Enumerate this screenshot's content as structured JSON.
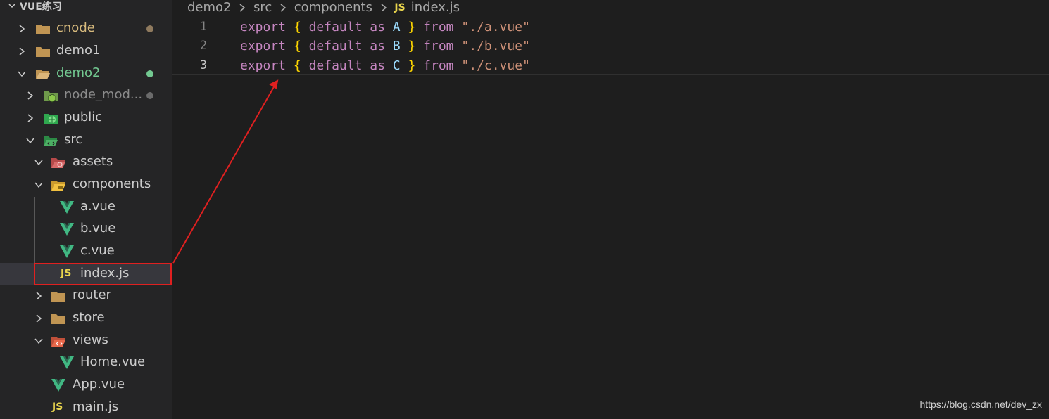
{
  "explorer": {
    "root_label": "VUE练习",
    "items": [
      {
        "label": "cnode"
      },
      {
        "label": "demo1"
      },
      {
        "label": "demo2"
      },
      {
        "label": "node_mod..."
      },
      {
        "label": "public"
      },
      {
        "label": "src"
      },
      {
        "label": "assets"
      },
      {
        "label": "components"
      },
      {
        "label": "a.vue"
      },
      {
        "label": "b.vue"
      },
      {
        "label": "c.vue"
      },
      {
        "label": "index.js"
      },
      {
        "label": "router"
      },
      {
        "label": "store"
      },
      {
        "label": "views"
      },
      {
        "label": "Home.vue"
      },
      {
        "label": "App.vue"
      },
      {
        "label": "main.js"
      }
    ],
    "js_badge": "JS"
  },
  "breadcrumb": {
    "items": [
      "demo2",
      "src",
      "components"
    ],
    "file_icon": "JS",
    "file": "index.js"
  },
  "editor": {
    "lines": [
      {
        "number": "1",
        "kw": "export",
        "open": "{",
        "def": "default",
        "as": "as",
        "name": "A",
        "close": "}",
        "from": "from",
        "path": "\"./a.vue\""
      },
      {
        "number": "2",
        "kw": "export",
        "open": "{",
        "def": "default",
        "as": "as",
        "name": "B",
        "close": "}",
        "from": "from",
        "path": "\"./b.vue\""
      },
      {
        "number": "3",
        "kw": "export",
        "open": "{",
        "def": "default",
        "as": "as",
        "name": "C",
        "close": "}",
        "from": "from",
        "path": "\"./c.vue\""
      }
    ]
  },
  "watermark": "https://blog.csdn.net/dev_zx",
  "colors": {
    "modified_dot": "#8f7a5e",
    "untracked_dot": "#73c991",
    "annotation": "#e02020"
  }
}
